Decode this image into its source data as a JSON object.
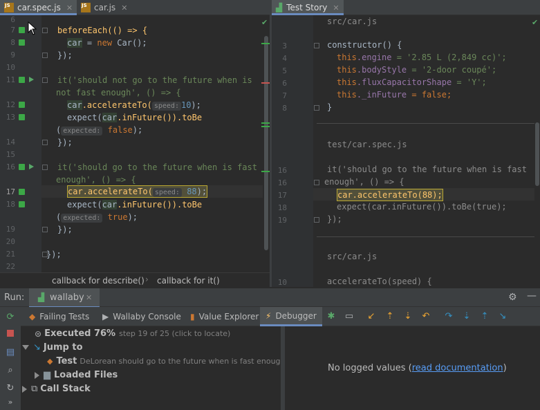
{
  "tabs": [
    {
      "label": "car.spec.js",
      "icon": "js-file-icon"
    },
    {
      "label": "car.js",
      "icon": "js-file-icon"
    }
  ],
  "story_tab": {
    "label": "Test Story",
    "icon": "wallaby-icon"
  },
  "editor": {
    "line_numbers": [
      "6",
      "7",
      "8",
      "9",
      "10",
      "11",
      "",
      "12",
      "13",
      "",
      "14",
      "15",
      "16",
      "",
      "17",
      "18",
      "",
      "19",
      "20",
      "21",
      "22"
    ],
    "lines": {
      "l7": "beforeEach(() => {",
      "l8_var": "car",
      "l8_rest": " = ",
      "l8_new": "new",
      "l8_ctor": " Car();",
      "l9": "});",
      "l11a": "it('should not go to the future when is",
      "l11b": "not fast enough', () => {",
      "l12_obj": "car",
      "l12_call": ".accelerateTo(",
      "l12_hint": "speed:",
      "l12_val": "10",
      "l12_end": ");",
      "l13a": "expect(",
      "l13_obj": "car",
      "l13_call": ".inFuture()).",
      "l13_tobe": "toBe",
      "l13b_paren": "(",
      "l13b_hint": "expected:",
      "l13b_val": "false",
      "l13b_end": ");",
      "l14": "});",
      "l16a": "it('should go to the future when is fast",
      "l16b": "enough', () => {",
      "l17_call": "car.accelerateTo(",
      "l17_hint": "speed:",
      "l17_val": "88",
      "l17_end": ");",
      "l18a": "expect(",
      "l18_obj": "car",
      "l18_call": ".inFuture()).",
      "l18_tobe": "toBe",
      "l18b_paren": "(",
      "l18b_hint": "expected:",
      "l18b_val": "true",
      "l18b_end": ");",
      "l19": "});",
      "l21": "});"
    }
  },
  "breadcrumbs": [
    "callback for describe()",
    "callback for it()"
  ],
  "story": {
    "file1": "src/car.js",
    "ctor_lines": [
      "3",
      "4",
      "5",
      "6",
      "7",
      "8"
    ],
    "ctor": "constructor() {",
    "engine_this": "this",
    "engine_prop": ".engine",
    "engine_val": " = '2.85 L (2,849 cc)';",
    "body_this": "this",
    "body_prop": ".bodyStyle",
    "body_val": " = '2-door coupé';",
    "flux_this": "this",
    "flux_prop": ".fluxCapacitorShape",
    "flux_val": " = 'Y';",
    "infut_this": "this",
    "infut_prop": "._inFuture",
    "infut_val": " = false;",
    "close": "}",
    "file2": "test/car.spec.js",
    "spec_lines": [
      "16",
      "16",
      "17",
      "18",
      "19"
    ],
    "spec1": "it('should go to the future when is fast",
    "spec2": "enough', () => {",
    "spec3": "car.accelerateTo(88);",
    "spec4": "expect(car.inFuture()).toBe(true);",
    "spec5": "});",
    "file3": "src/car.js",
    "acc_line": "10",
    "acc": "accelerateTo(speed) {"
  },
  "run_bar": {
    "label": "Run:",
    "config": "wallaby"
  },
  "bottom_tabs": [
    "Failing Tests",
    "Wallaby Console",
    "Value Explorer",
    "Debugger"
  ],
  "debugger": {
    "executed_label": "Executed 76%",
    "executed_detail": "step 19 of 25 (click to locate)",
    "jump_to": "Jump to",
    "test_label": "Test",
    "test_name": "DeLorean should go to the future when is fast enough",
    "loaded_files": "Loaded Files",
    "call_stack": "Call Stack",
    "no_values": "No logged values (",
    "read_docs": "read documentation",
    "close_paren": ")"
  },
  "colors": {
    "accent": "#6a8bbf",
    "coverage": "#3ca847",
    "highlight": "#bba832",
    "link": "#589df6"
  }
}
